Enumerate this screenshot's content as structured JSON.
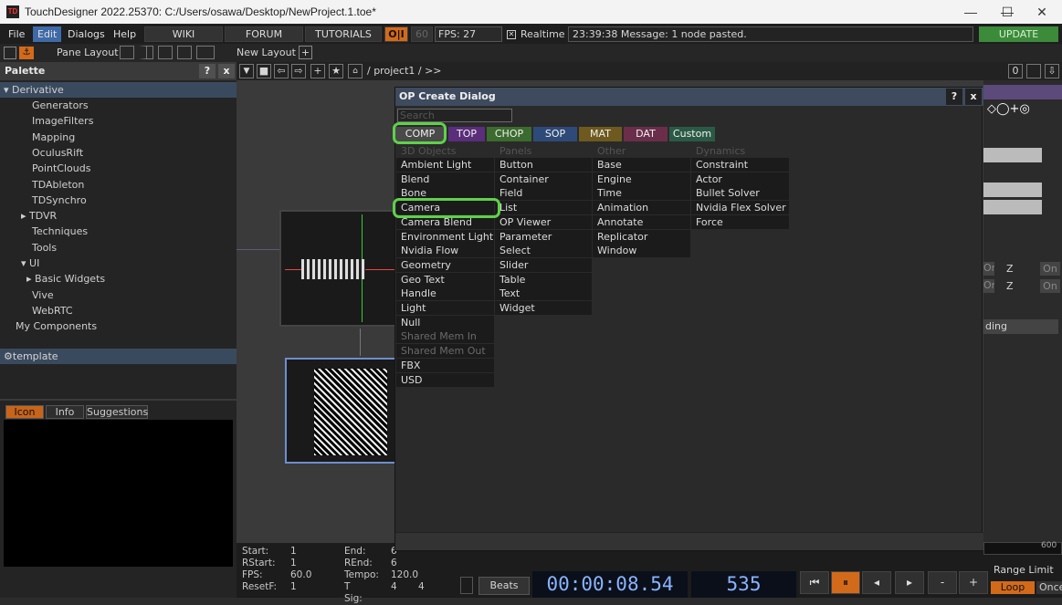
{
  "window": {
    "title": "TouchDesigner 2022.25370: C:/Users/osawa/Desktop/NewProject.1.toe*",
    "minimize": "—",
    "maximize": "☐",
    "close": "✕"
  },
  "menu": {
    "items": [
      "File",
      "Edit",
      "Dialogs",
      "Help"
    ],
    "wiki": "WIKI",
    "forum": "FORUM",
    "tutorials": "TUTORIALS",
    "oi": "O|I",
    "fps60": "60",
    "fps": "FPS:  27",
    "realtime": "Realtime",
    "message": "23:39:38 Message: 1 node pasted.",
    "update": "UPDATE"
  },
  "toolbar": {
    "pane_layout": "Pane Layout",
    "new_layout": "New Layout",
    "path": "/ project1 / >>"
  },
  "palette": {
    "title": "Palette",
    "help": "?",
    "close": "x",
    "root": "Derivative",
    "items": [
      {
        "label": "Generators",
        "indent": 1,
        "arrow": ""
      },
      {
        "label": "ImageFilters",
        "indent": 1,
        "arrow": ""
      },
      {
        "label": "Mapping",
        "indent": 1,
        "arrow": ""
      },
      {
        "label": "OculusRift",
        "indent": 1,
        "arrow": ""
      },
      {
        "label": "PointClouds",
        "indent": 1,
        "arrow": ""
      },
      {
        "label": "TDAbleton",
        "indent": 1,
        "arrow": ""
      },
      {
        "label": "TDSynchro",
        "indent": 1,
        "arrow": ""
      },
      {
        "label": "TDVR",
        "indent": 1,
        "arrow": "▸"
      },
      {
        "label": "Techniques",
        "indent": 1,
        "arrow": ""
      },
      {
        "label": "Tools",
        "indent": 1,
        "arrow": ""
      },
      {
        "label": "UI",
        "indent": 1,
        "arrow": "▾"
      },
      {
        "label": "Basic Widgets",
        "indent": 2,
        "arrow": "▸"
      },
      {
        "label": "Vive",
        "indent": 1,
        "arrow": ""
      },
      {
        "label": "WebRTC",
        "indent": 1,
        "arrow": ""
      },
      {
        "label": "My Components",
        "indent": 0,
        "arrow": ""
      }
    ],
    "template": "template",
    "tabs": [
      "Icon",
      "Info",
      "Suggestions"
    ]
  },
  "dialog": {
    "title": "OP Create Dialog",
    "help": "?",
    "close": "x",
    "search_placeholder": "Search",
    "tabs": [
      {
        "label": "COMP",
        "color": "#4a4a4a"
      },
      {
        "label": "TOP",
        "color": "#5a2e7a"
      },
      {
        "label": "CHOP",
        "color": "#3b6b2e"
      },
      {
        "label": "SOP",
        "color": "#2e4a78"
      },
      {
        "label": "MAT",
        "color": "#6e5a1e"
      },
      {
        "label": "DAT",
        "color": "#6a2e4a"
      },
      {
        "label": "Custom",
        "color": "#2a5a45"
      }
    ],
    "columns": [
      {
        "header": "3D Objects",
        "items": [
          "Ambient Light",
          "Blend",
          "Bone",
          "Camera",
          "Camera Blend",
          "Environment Light",
          "Nvidia Flow Emitter",
          "Geometry",
          "Geo Text",
          "Handle",
          "Light",
          "Null",
          "Shared Mem In",
          "Shared Mem Out",
          "FBX",
          "USD"
        ],
        "dim": [
          12,
          13
        ]
      },
      {
        "header": "Panels",
        "items": [
          "Button",
          "Container",
          "Field",
          "List",
          "OP Viewer",
          "Parameter",
          "Select",
          "Slider",
          "Table",
          "Text",
          "Widget"
        ],
        "dim": []
      },
      {
        "header": "Other",
        "items": [
          "Base",
          "Engine",
          "Time",
          "Animation",
          "Annotate",
          "Replicator",
          "Window"
        ],
        "dim": []
      },
      {
        "header": "Dynamics",
        "items": [
          "Constraint",
          "Actor",
          "Bullet Solver",
          "Nvidia Flex Solver",
          "Force"
        ],
        "dim": []
      }
    ]
  },
  "params": {
    "z1": "Z",
    "on1": "On",
    "z2": "Z",
    "on2": "On",
    "on3": "On",
    "on4": "On",
    "ding": "ding",
    "range_limit": "Range Limit",
    "loop": "Loop",
    "once": "Once",
    "scale600": "600"
  },
  "timeline": {
    "start_lbl": "Start:",
    "start": "1",
    "end_lbl": "End:",
    "end": "6",
    "rstart_lbl": "RStart:",
    "rstart": "1",
    "rend_lbl": "REnd:",
    "rend": "6",
    "fps_lbl": "FPS:",
    "fps": "60.0",
    "tempo_lbl": "Tempo:",
    "tempo": "120.0",
    "resetf_lbl": "ResetF:",
    "resetf": "1",
    "tsig_lbl": "T Sig:",
    "tsig_a": "4",
    "tsig_b": "4",
    "beats": "Beats",
    "timecode": "00:00:08.54",
    "frame": "535",
    "btns": [
      "⏮",
      "⏸",
      "◂",
      "▸",
      "-",
      "+"
    ]
  }
}
